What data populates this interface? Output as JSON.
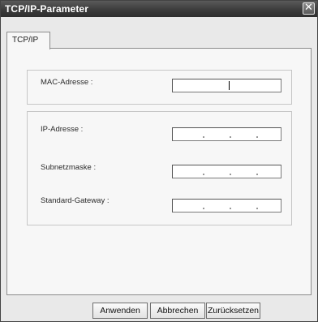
{
  "window": {
    "title": "TCP/IP-Parameter",
    "close_glyph": "✕"
  },
  "tabs": [
    {
      "label": "TCP/IP"
    }
  ],
  "fields": {
    "mac": {
      "label": "MAC-Adresse :",
      "value": ""
    },
    "ip": {
      "label": "IP-Adresse :",
      "value": ".   .   ."
    },
    "subnet": {
      "label": "Subnetzmaske :",
      "value": ".   .   ."
    },
    "gateway": {
      "label": "Standard-Gateway :",
      "value": ".   .   ."
    }
  },
  "buttons": {
    "apply": "Anwenden",
    "cancel": "Abbrechen",
    "reset": "Zurücksetzen"
  }
}
